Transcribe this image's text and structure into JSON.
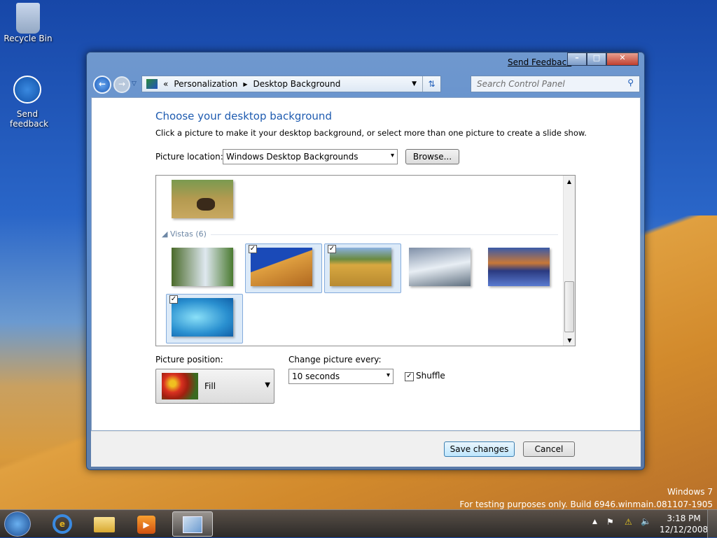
{
  "desktop": {
    "icons": [
      {
        "label": "Recycle Bin"
      },
      {
        "label": "Send feedback"
      }
    ],
    "watermark": {
      "line1": "Windows 7",
      "line2": "For testing purposes only. Build 6946.winmain.081107-1905"
    }
  },
  "window": {
    "send_feedback": "Send Feedback",
    "breadcrumb": [
      "Personalization",
      "Desktop Background"
    ],
    "search_placeholder": "Search Control Panel"
  },
  "main": {
    "title": "Choose your desktop background",
    "subtitle": "Click a picture to make it your desktop background, or select more than one picture to create a slide show.",
    "location_label": "Picture location:",
    "location_value": "Windows Desktop Backgrounds",
    "browse": "Browse...",
    "group": "Vistas (6)",
    "pictures": [
      {
        "name": "bison",
        "checked": false
      },
      {
        "name": "waterfall",
        "checked": false
      },
      {
        "name": "dune",
        "checked": true
      },
      {
        "name": "wheat",
        "checked": true
      },
      {
        "name": "mountains",
        "checked": false
      },
      {
        "name": "lake",
        "checked": false
      },
      {
        "name": "aurora",
        "checked": true
      }
    ],
    "position_label": "Picture position:",
    "position_value": "Fill",
    "interval_label": "Change picture every:",
    "interval_value": "10 seconds",
    "shuffle": "Shuffle"
  },
  "footer": {
    "save": "Save changes",
    "cancel": "Cancel"
  },
  "tray": {
    "time": "3:18 PM",
    "date": "12/12/2008"
  },
  "colors": {
    "title": "#1e5bb0"
  }
}
